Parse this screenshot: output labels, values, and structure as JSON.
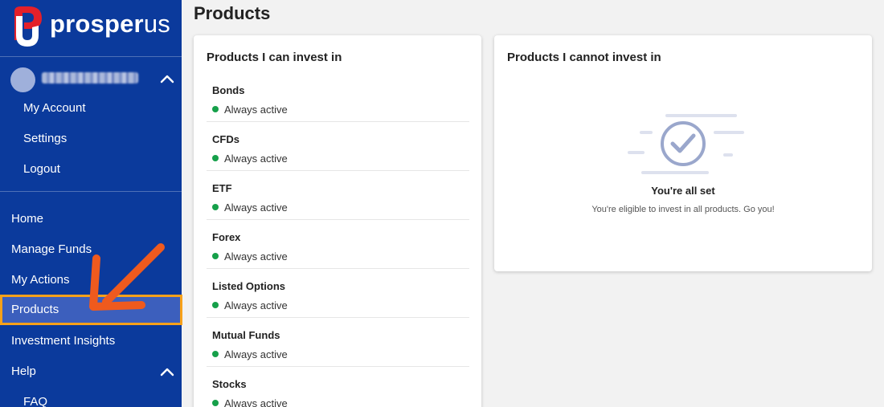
{
  "brand": {
    "name_main": "prosper",
    "name_suffix": "us",
    "accent": "#e4202a"
  },
  "header": {
    "title": "Products"
  },
  "sidebar": {
    "account_menu": [
      "My Account",
      "Settings",
      "Logout"
    ],
    "items": [
      {
        "label": "Home"
      },
      {
        "label": "Manage Funds"
      },
      {
        "label": "My Actions"
      },
      {
        "label": "Products",
        "active": true
      },
      {
        "label": "Investment Insights"
      },
      {
        "label": "Help"
      }
    ],
    "help_submenu": [
      "FAQ"
    ]
  },
  "can_invest": {
    "title": "Products I can invest in",
    "status_color": "#16a04a",
    "products": [
      {
        "name": "Bonds",
        "status": "Always active"
      },
      {
        "name": "CFDs",
        "status": "Always active"
      },
      {
        "name": "ETF",
        "status": "Always active"
      },
      {
        "name": "Forex",
        "status": "Always active"
      },
      {
        "name": "Listed Options",
        "status": "Always active"
      },
      {
        "name": "Mutual Funds",
        "status": "Always active"
      },
      {
        "name": "Stocks",
        "status": "Always active"
      }
    ]
  },
  "cannot_invest": {
    "title": "Products I cannot invest in",
    "empty_title": "You're all set",
    "empty_message": "You're eligible to invest in all products. Go you!"
  },
  "colors": {
    "sidebar": "#0b3a9c",
    "active_item": "#3c5fbd",
    "highlight": "#f7a11a",
    "arrow": "#ef5a1e"
  }
}
